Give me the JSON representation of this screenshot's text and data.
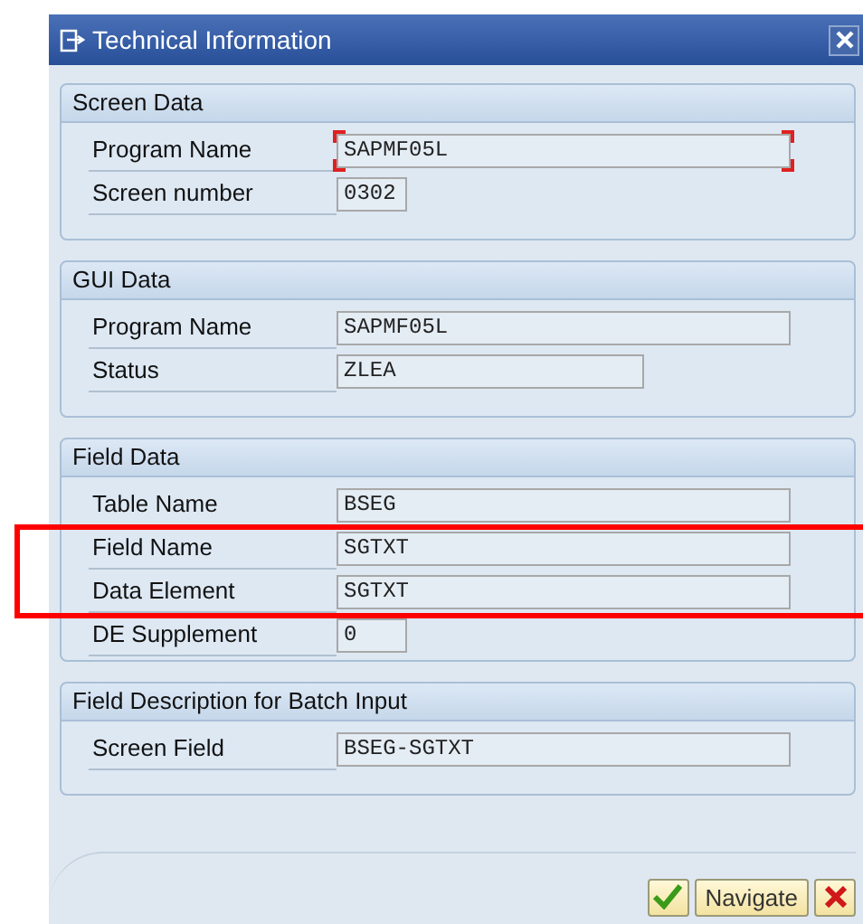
{
  "window": {
    "title": "Technical Information"
  },
  "groups": [
    {
      "title": "Screen Data",
      "rows": [
        {
          "label": "Program Name",
          "value": "SAPMF05L",
          "kind": "long",
          "focused": true
        },
        {
          "label": "Screen number",
          "value": "0302",
          "kind": "short",
          "focused": false
        }
      ]
    },
    {
      "title": "GUI Data",
      "rows": [
        {
          "label": "Program Name",
          "value": "SAPMF05L",
          "kind": "long",
          "focused": false
        },
        {
          "label": "Status",
          "value": "ZLEA",
          "kind": "medium",
          "focused": false
        }
      ]
    },
    {
      "title": "Field Data",
      "rows": [
        {
          "label": "Table Name",
          "value": "BSEG",
          "kind": "long",
          "focused": false
        },
        {
          "label": "Field Name",
          "value": "SGTXT",
          "kind": "long",
          "focused": false
        },
        {
          "label": "Data Element",
          "value": "SGTXT",
          "kind": "long",
          "focused": false
        },
        {
          "label": "DE Supplement",
          "value": "0",
          "kind": "short",
          "focused": false
        }
      ]
    },
    {
      "title": "Field Description for Batch Input",
      "rows": [
        {
          "label": "Screen Field",
          "value": "BSEG-SGTXT",
          "kind": "long",
          "focused": false
        }
      ]
    }
  ],
  "buttons": [
    {
      "kind": "confirm"
    },
    {
      "kind": "text",
      "label": "Navigate"
    },
    {
      "kind": "cancel"
    }
  ]
}
